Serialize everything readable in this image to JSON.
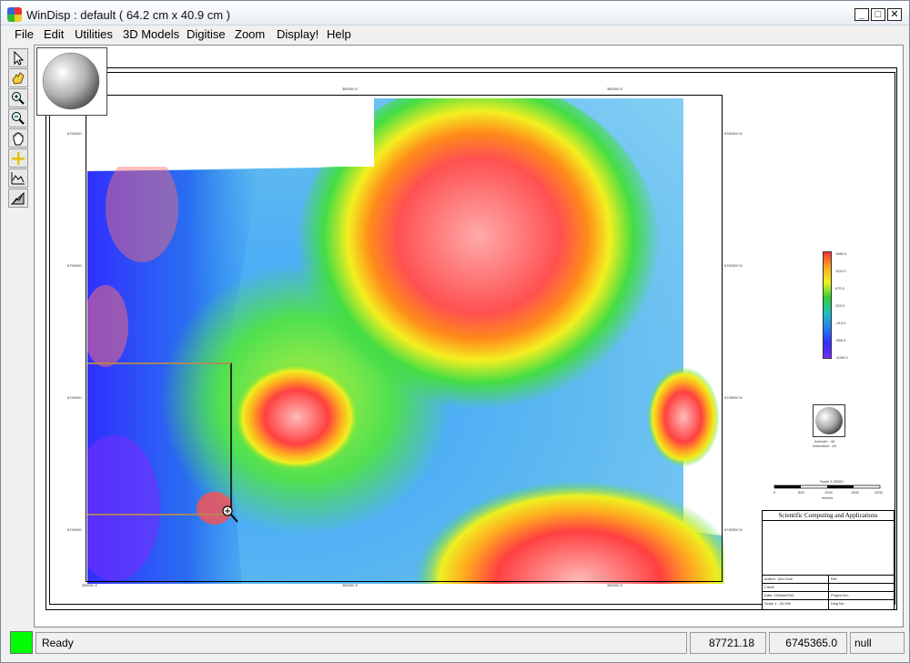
{
  "window": {
    "title": "WinDisp : default ( 64.2 cm x 40.9 cm )"
  },
  "menu": [
    "File",
    "Edit",
    "Utilities",
    "3D Models",
    "Digitise",
    "Zoom",
    "Display!",
    "Help"
  ],
  "tools": [
    "pointer-icon",
    "pan-hand-icon",
    "zoom-in-icon",
    "zoom-out-icon",
    "grab-hand-icon",
    "crosshair-icon",
    "profile-line-icon",
    "surface-3d-icon"
  ],
  "map": {
    "top_ticks": [
      "380000 E",
      "380000 E"
    ],
    "bottom_ticks": [
      "380000 E",
      "380000 E",
      "380000 E"
    ],
    "left_ticks": [
      "6760000",
      "6750000",
      "6745000",
      "6740000"
    ],
    "right_ticks": [
      "6760000 N",
      "6750000 N",
      "6745000 N",
      "6740000 N"
    ]
  },
  "legend": {
    "labels": [
      "1560.0",
      "1110.0",
      "670.0",
      "225.0",
      "-215.0",
      "-655.0",
      "-1095.0"
    ]
  },
  "sun": {
    "azimuth": "Azimuth : 45",
    "inclination": "Inclination : 45"
  },
  "scale": {
    "title": "Scale 1:25000",
    "ticks": [
      "0",
      "500",
      "1000",
      "1500",
      "2000"
    ],
    "unit": "metres"
  },
  "titleblock": {
    "company": "Scientific Computing and Applications",
    "author": "Author: John Doe",
    "client": "Client:",
    "date": "Date: 10/Mar/2011",
    "scale": "Scale 1 : 25 000",
    "ref": "Ref:",
    "project": "Project No.:",
    "drawing": "Dwg No.:"
  },
  "status": {
    "ready": "Ready",
    "x": "87721.18",
    "y": "6745365.0",
    "z": "null",
    "indicator_color": "#00ff00"
  }
}
